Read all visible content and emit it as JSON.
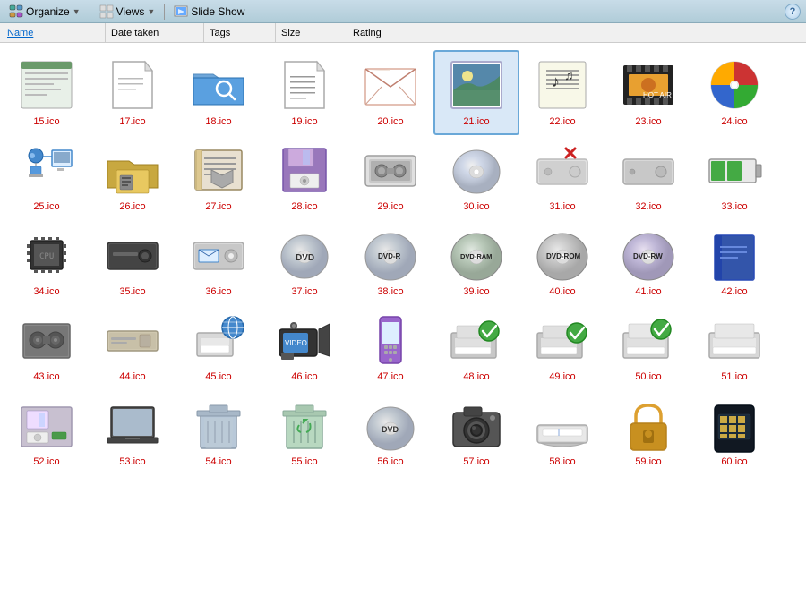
{
  "toolbar": {
    "organize_label": "Organize",
    "views_label": "Views",
    "slideshow_label": "Slide Show",
    "help_label": "?"
  },
  "columns": {
    "name": "Name",
    "date_taken": "Date taken",
    "tags": "Tags",
    "size": "Size",
    "rating": "Rating"
  },
  "files": [
    {
      "id": "15",
      "label": "15.ico",
      "type": "webpage"
    },
    {
      "id": "17",
      "label": "17.ico",
      "type": "document_corner"
    },
    {
      "id": "18",
      "label": "18.ico",
      "type": "folder_search"
    },
    {
      "id": "19",
      "label": "19.ico",
      "type": "document"
    },
    {
      "id": "20",
      "label": "20.ico",
      "type": "envelope"
    },
    {
      "id": "21",
      "label": "21.ico",
      "type": "photo",
      "selected": true
    },
    {
      "id": "22",
      "label": "22.ico",
      "type": "music"
    },
    {
      "id": "23",
      "label": "23.ico",
      "type": "film"
    },
    {
      "id": "24",
      "label": "24.ico",
      "type": "windows_logo"
    },
    {
      "id": "25",
      "label": "25.ico",
      "type": "network_computer"
    },
    {
      "id": "26",
      "label": "26.ico",
      "type": "folder_printer"
    },
    {
      "id": "27",
      "label": "27.ico",
      "type": "book_drive"
    },
    {
      "id": "28",
      "label": "28.ico",
      "type": "floppy_purple"
    },
    {
      "id": "29",
      "label": "29.ico",
      "type": "tape_drive"
    },
    {
      "id": "30",
      "label": "30.ico",
      "type": "cd_disc"
    },
    {
      "id": "31",
      "label": "31.ico",
      "type": "drive_x"
    },
    {
      "id": "32",
      "label": "32.ico",
      "type": "drive_gray"
    },
    {
      "id": "33",
      "label": "33.ico",
      "type": "battery"
    },
    {
      "id": "34",
      "label": "34.ico",
      "type": "chip"
    },
    {
      "id": "35",
      "label": "35.ico",
      "type": "drive_black"
    },
    {
      "id": "36",
      "label": "36.ico",
      "type": "drive_windows"
    },
    {
      "id": "37",
      "label": "37.ico",
      "type": "dvd_disc"
    },
    {
      "id": "38",
      "label": "38.ico",
      "type": "dvd_r"
    },
    {
      "id": "39",
      "label": "39.ico",
      "type": "dvd_ram"
    },
    {
      "id": "40",
      "label": "40.ico",
      "type": "dvd_rom"
    },
    {
      "id": "41",
      "label": "41.ico",
      "type": "dvd_rw"
    },
    {
      "id": "42",
      "label": "42.ico",
      "type": "book_blue"
    },
    {
      "id": "43",
      "label": "43.ico",
      "type": "tape_small"
    },
    {
      "id": "44",
      "label": "44.ico",
      "type": "drive_flat"
    },
    {
      "id": "45",
      "label": "45.ico",
      "type": "printer_globe"
    },
    {
      "id": "46",
      "label": "46.ico",
      "type": "camcorder"
    },
    {
      "id": "47",
      "label": "47.ico",
      "type": "phone"
    },
    {
      "id": "48",
      "label": "48.ico",
      "type": "printer_check"
    },
    {
      "id": "49",
      "label": "49.ico",
      "type": "printer_check2"
    },
    {
      "id": "50",
      "label": "50.ico",
      "type": "printer_check3"
    },
    {
      "id": "51",
      "label": "51.ico",
      "type": "printer_plain"
    },
    {
      "id": "52",
      "label": "52.ico",
      "type": "floppy_drive"
    },
    {
      "id": "53",
      "label": "53.ico",
      "type": "laptop"
    },
    {
      "id": "54",
      "label": "54.ico",
      "type": "trash_full"
    },
    {
      "id": "55",
      "label": "55.ico",
      "type": "trash_recycle"
    },
    {
      "id": "56",
      "label": "56.ico",
      "type": "dvd_disc2"
    },
    {
      "id": "57",
      "label": "57.ico",
      "type": "camera"
    },
    {
      "id": "58",
      "label": "58.ico",
      "type": "scanner"
    },
    {
      "id": "59",
      "label": "59.ico",
      "type": "padlock"
    },
    {
      "id": "60",
      "label": "60.ico",
      "type": "chip_card"
    }
  ]
}
